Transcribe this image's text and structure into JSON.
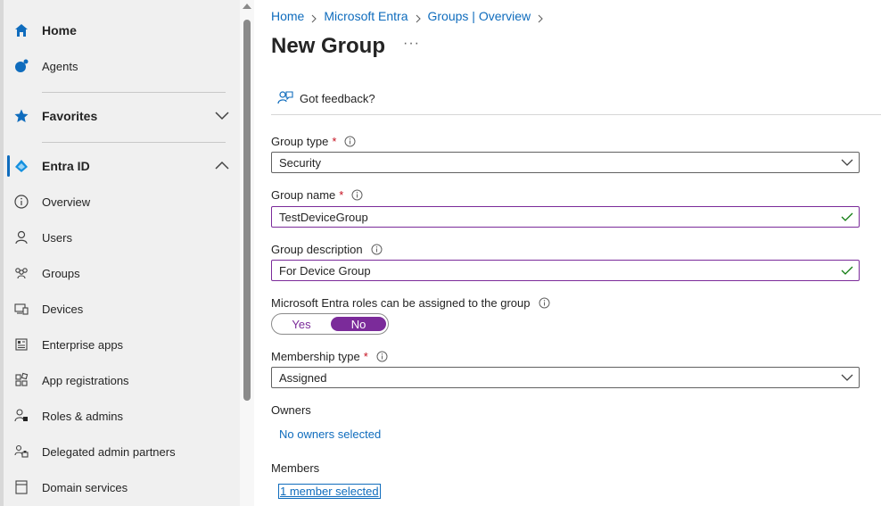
{
  "sidebar": {
    "items": [
      {
        "label": "Home",
        "icon": "home-icon"
      },
      {
        "label": "Agents",
        "icon": "agents-icon"
      },
      {
        "label": "Favorites",
        "icon": "star-icon"
      },
      {
        "label": "Entra ID",
        "icon": "entra-id-icon"
      },
      {
        "label": "Overview",
        "icon": "info-icon"
      },
      {
        "label": "Users",
        "icon": "user-icon"
      },
      {
        "label": "Groups",
        "icon": "groups-icon"
      },
      {
        "label": "Devices",
        "icon": "devices-icon"
      },
      {
        "label": "Enterprise apps",
        "icon": "enterprise-apps-icon"
      },
      {
        "label": "App registrations",
        "icon": "app-registrations-icon"
      },
      {
        "label": "Roles & admins",
        "icon": "roles-icon"
      },
      {
        "label": "Delegated admin partners",
        "icon": "delegated-admin-icon"
      },
      {
        "label": "Domain services",
        "icon": "domain-services-icon"
      }
    ]
  },
  "breadcrumb": [
    "Home",
    "Microsoft Entra",
    "Groups | Overview"
  ],
  "page": {
    "title": "New Group",
    "more": "···",
    "feedback": "Got feedback?"
  },
  "form": {
    "group_type": {
      "label": "Group type",
      "required": "*",
      "value": "Security"
    },
    "group_name": {
      "label": "Group name",
      "required": "*",
      "value": "TestDeviceGroup"
    },
    "group_description": {
      "label": "Group description",
      "value": "For Device Group"
    },
    "roles_assignable": {
      "label": "Microsoft Entra roles can be assigned to the group",
      "yes": "Yes",
      "no": "No",
      "selected": "No"
    },
    "membership_type": {
      "label": "Membership type",
      "required": "*",
      "value": "Assigned"
    },
    "owners": {
      "label": "Owners",
      "link": "No owners selected"
    },
    "members": {
      "label": "Members",
      "link": "1 member selected"
    }
  },
  "colors": {
    "accent": "#0f6cbd",
    "toggle_on": "#7b2b9a",
    "valid_check": "#107c10",
    "required": "#c50f1f"
  }
}
